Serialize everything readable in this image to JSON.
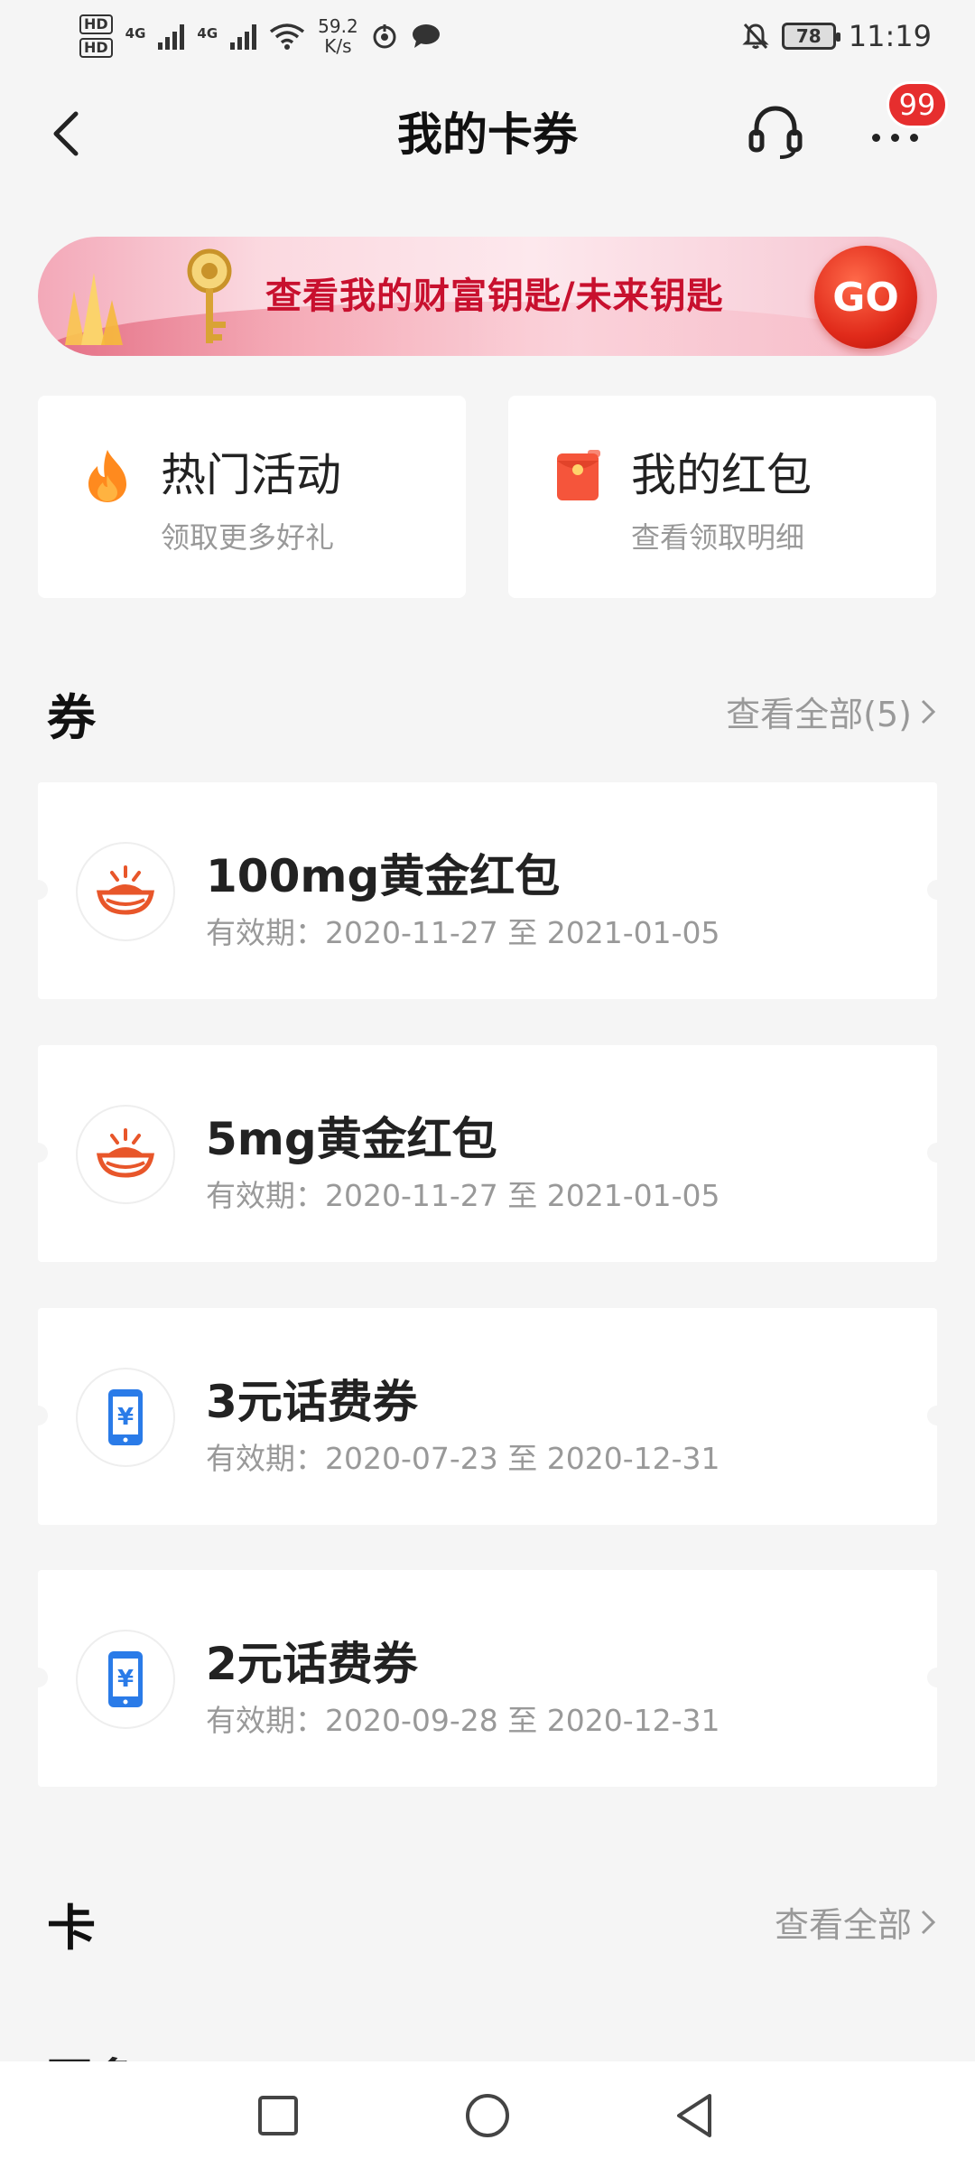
{
  "status_bar": {
    "hd1": "HD",
    "hd2": "HD",
    "net1": "4G",
    "net2": "4G",
    "speed_value": "59.2",
    "speed_unit": "K/s",
    "battery": "78",
    "time": "11:19"
  },
  "nav": {
    "title": "我的卡券",
    "badge": "99"
  },
  "banner": {
    "text": "查看我的财富钥匙/未来钥匙",
    "go_label": "GO"
  },
  "quick_cards": [
    {
      "title": "热门活动",
      "subtitle": "领取更多好礼",
      "icon": "flame-icon"
    },
    {
      "title": "我的红包",
      "subtitle": "查看领取明细",
      "icon": "red-envelope-icon"
    }
  ],
  "coupons_section": {
    "title": "券",
    "view_all": "查看全部(5)"
  },
  "coupons": [
    {
      "title": "100mg黄金红包",
      "validity": "有效期：2020-11-27 至 2021-01-05",
      "icon": "gold-ingot-icon"
    },
    {
      "title": "5mg黄金红包",
      "validity": "有效期：2020-11-27 至 2021-01-05",
      "icon": "gold-ingot-icon"
    },
    {
      "title": "3元话费券",
      "validity": "有效期：2020-07-23 至 2020-12-31",
      "icon": "phone-yuan-icon"
    },
    {
      "title": "2元话费券",
      "validity": "有效期：2020-09-28 至 2020-12-31",
      "icon": "phone-yuan-icon"
    }
  ],
  "cards_section": {
    "title": "卡",
    "view_all": "查看全部"
  },
  "partial_text": "更多",
  "colors": {
    "accent_red": "#e62e2e",
    "banner_text": "#c8102e",
    "gold_icon": "#e8562a",
    "phone_icon": "#2a7be8",
    "background": "#f5f5f5"
  }
}
